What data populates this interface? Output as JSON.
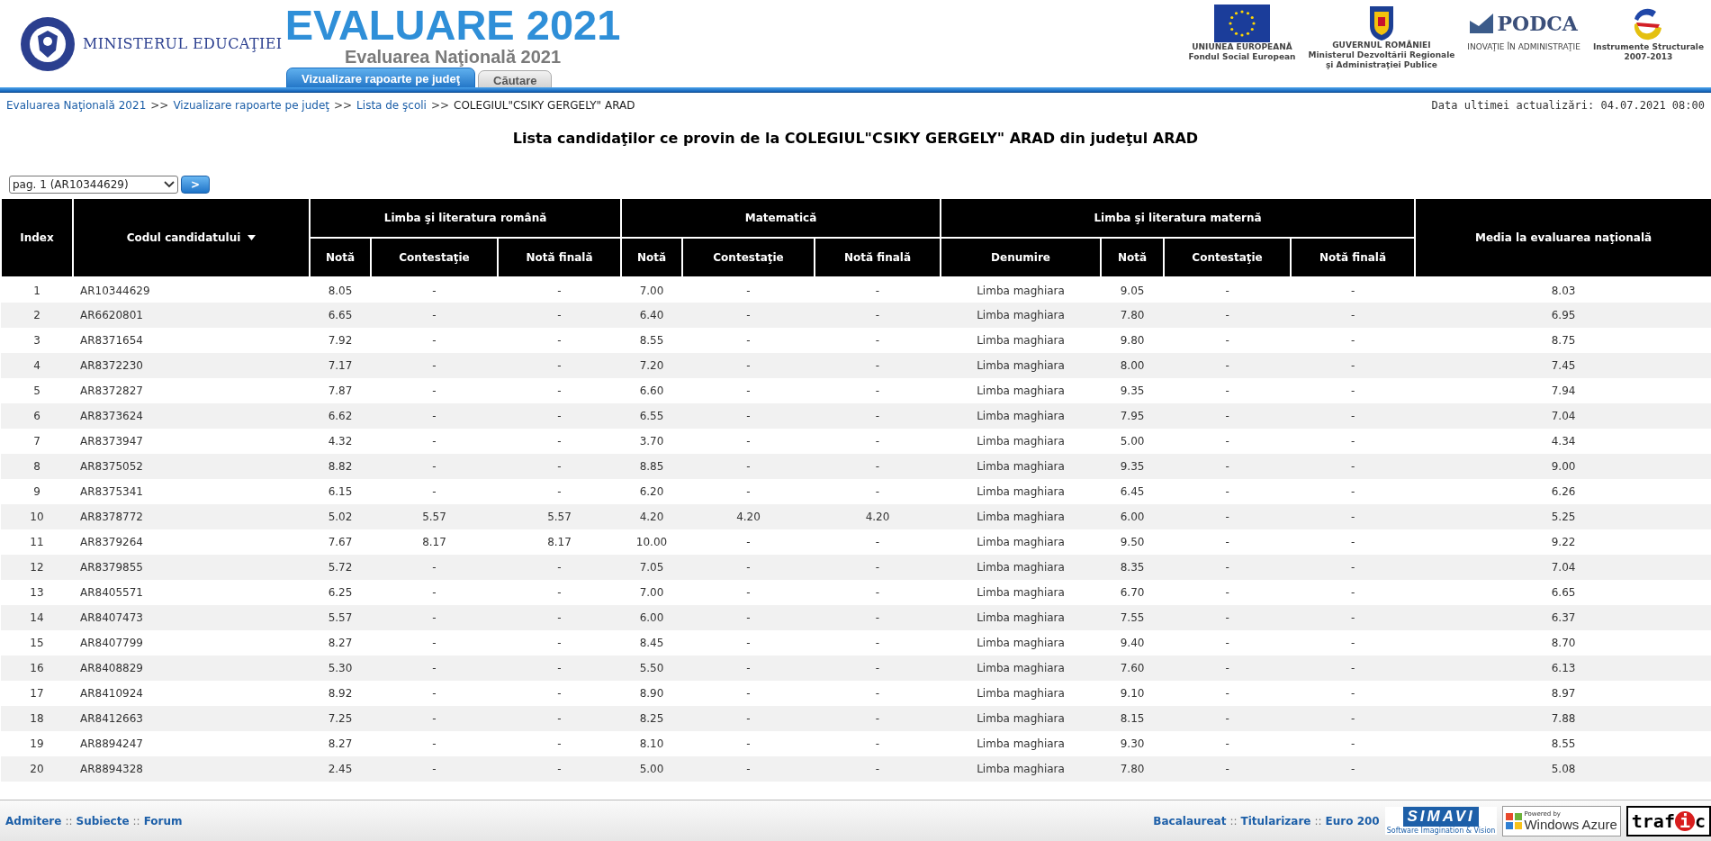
{
  "header": {
    "ministry": "MINISTERUL EDUCAŢIEI",
    "title": "EVALUARE 2021",
    "subtitle": "Evaluarea Naţională 2021",
    "partner_logos": [
      {
        "kind": "eu",
        "lines": [
          "UNIUNEA EUROPEANĂ",
          "Fondul Social European"
        ]
      },
      {
        "kind": "gov",
        "lines": [
          "GUVERNUL ROMÂNIEI",
          "Ministerul Dezvoltării Regionale",
          "şi Administraţiei Publice"
        ]
      },
      {
        "kind": "podca",
        "lines": [
          "PODCA",
          "INOVAŢIE ÎN ADMINISTRAŢIE"
        ]
      },
      {
        "kind": "is",
        "lines": [
          "Instrumente Structurale",
          "2007-2013"
        ]
      }
    ]
  },
  "tabs": [
    {
      "label": "Vizualizare rapoarte pe judeţ",
      "selected": true
    },
    {
      "label": "Căutare",
      "selected": false
    }
  ],
  "breadcrumb": {
    "links": [
      "Evaluarea Naţională 2021",
      "Vizualizare rapoarte pe judeţ",
      "Lista de şcoli"
    ],
    "separator": ">>",
    "current": "COLEGIUL\"CSIKY GERGELY\" ARAD"
  },
  "last_update": "Data ultimei actualizări: 04.07.2021 08:00",
  "page_title": "Lista candidaţilor ce provin de la COLEGIUL\"CSIKY GERGELY\" ARAD din judeţul ARAD",
  "pager": {
    "value": "pag. 1 (AR10344629)",
    "button": ">"
  },
  "table": {
    "header": [
      {
        "kind": "single",
        "label": "Index"
      },
      {
        "kind": "single",
        "label": "Codul candidatului",
        "sort": true
      },
      {
        "kind": "group",
        "label": "Limba şi literatura română",
        "columns": [
          "Notă",
          "Contestaţie",
          "Notă finală"
        ]
      },
      {
        "kind": "group",
        "label": "Matematică",
        "columns": [
          "Notă",
          "Contestaţie",
          "Notă finală"
        ]
      },
      {
        "kind": "group",
        "label": "Limba şi literatura maternă",
        "columns": [
          "Denumire",
          "Notă",
          "Contestaţie",
          "Notă finală"
        ]
      },
      {
        "kind": "single",
        "label": "Media la evaluarea naţională"
      }
    ],
    "rows": [
      [
        "1",
        "AR10344629",
        "8.05",
        "-",
        "-",
        "7.00",
        "-",
        "-",
        "Limba maghiara",
        "9.05",
        "-",
        "-",
        "8.03"
      ],
      [
        "2",
        "AR6620801",
        "6.65",
        "-",
        "-",
        "6.40",
        "-",
        "-",
        "Limba maghiara",
        "7.80",
        "-",
        "-",
        "6.95"
      ],
      [
        "3",
        "AR8371654",
        "7.92",
        "-",
        "-",
        "8.55",
        "-",
        "-",
        "Limba maghiara",
        "9.80",
        "-",
        "-",
        "8.75"
      ],
      [
        "4",
        "AR8372230",
        "7.17",
        "-",
        "-",
        "7.20",
        "-",
        "-",
        "Limba maghiara",
        "8.00",
        "-",
        "-",
        "7.45"
      ],
      [
        "5",
        "AR8372827",
        "7.87",
        "-",
        "-",
        "6.60",
        "-",
        "-",
        "Limba maghiara",
        "9.35",
        "-",
        "-",
        "7.94"
      ],
      [
        "6",
        "AR8373624",
        "6.62",
        "-",
        "-",
        "6.55",
        "-",
        "-",
        "Limba maghiara",
        "7.95",
        "-",
        "-",
        "7.04"
      ],
      [
        "7",
        "AR8373947",
        "4.32",
        "-",
        "-",
        "3.70",
        "-",
        "-",
        "Limba maghiara",
        "5.00",
        "-",
        "-",
        "4.34"
      ],
      [
        "8",
        "AR8375052",
        "8.82",
        "-",
        "-",
        "8.85",
        "-",
        "-",
        "Limba maghiara",
        "9.35",
        "-",
        "-",
        "9.00"
      ],
      [
        "9",
        "AR8375341",
        "6.15",
        "-",
        "-",
        "6.20",
        "-",
        "-",
        "Limba maghiara",
        "6.45",
        "-",
        "-",
        "6.26"
      ],
      [
        "10",
        "AR8378772",
        "5.02",
        "5.57",
        "5.57",
        "4.20",
        "4.20",
        "4.20",
        "Limba maghiara",
        "6.00",
        "-",
        "-",
        "5.25"
      ],
      [
        "11",
        "AR8379264",
        "7.67",
        "8.17",
        "8.17",
        "10.00",
        "-",
        "-",
        "Limba maghiara",
        "9.50",
        "-",
        "-",
        "9.22"
      ],
      [
        "12",
        "AR8379855",
        "5.72",
        "-",
        "-",
        "7.05",
        "-",
        "-",
        "Limba maghiara",
        "8.35",
        "-",
        "-",
        "7.04"
      ],
      [
        "13",
        "AR8405571",
        "6.25",
        "-",
        "-",
        "7.00",
        "-",
        "-",
        "Limba maghiara",
        "6.70",
        "-",
        "-",
        "6.65"
      ],
      [
        "14",
        "AR8407473",
        "5.57",
        "-",
        "-",
        "6.00",
        "-",
        "-",
        "Limba maghiara",
        "7.55",
        "-",
        "-",
        "6.37"
      ],
      [
        "15",
        "AR8407799",
        "8.27",
        "-",
        "-",
        "8.45",
        "-",
        "-",
        "Limba maghiara",
        "9.40",
        "-",
        "-",
        "8.70"
      ],
      [
        "16",
        "AR8408829",
        "5.30",
        "-",
        "-",
        "5.50",
        "-",
        "-",
        "Limba maghiara",
        "7.60",
        "-",
        "-",
        "6.13"
      ],
      [
        "17",
        "AR8410924",
        "8.92",
        "-",
        "-",
        "8.90",
        "-",
        "-",
        "Limba maghiara",
        "9.10",
        "-",
        "-",
        "8.97"
      ],
      [
        "18",
        "AR8412663",
        "7.25",
        "-",
        "-",
        "8.25",
        "-",
        "-",
        "Limba maghiara",
        "8.15",
        "-",
        "-",
        "7.88"
      ],
      [
        "19",
        "AR8894247",
        "8.27",
        "-",
        "-",
        "8.10",
        "-",
        "-",
        "Limba maghiara",
        "9.30",
        "-",
        "-",
        "8.55"
      ],
      [
        "20",
        "AR8894328",
        "2.45",
        "-",
        "-",
        "5.00",
        "-",
        "-",
        "Limba maghiara",
        "7.80",
        "-",
        "-",
        "5.08"
      ]
    ]
  },
  "footer": {
    "separator": "::",
    "left_links": [
      "Admitere",
      "Subiecte",
      "Forum"
    ],
    "right_links": [
      "Bacalaureat",
      "Titularizare",
      "Euro 200"
    ],
    "sponsor_logos": [
      {
        "kind": "simavi",
        "lines": [
          "SIMAVI",
          "Software Imagination & Vision"
        ]
      },
      {
        "kind": "azure",
        "lines": [
          "Powered by",
          "Windows Azure"
        ]
      },
      {
        "kind": "trafic",
        "lines": [
          "traf",
          "i",
          "c"
        ]
      }
    ]
  }
}
